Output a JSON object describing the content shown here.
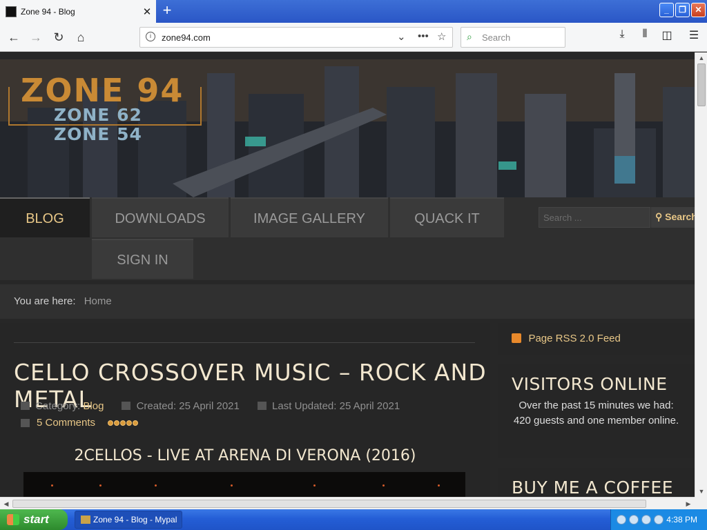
{
  "browser": {
    "tab_title": "Zone 94 - Blog",
    "new_tab": "+",
    "url": "zone94.com",
    "search_placeholder": "Search",
    "win_min": "_",
    "win_max": "❐",
    "win_close": "✕"
  },
  "site": {
    "logo_main": "ZONE 94",
    "logo_sub1": "ZONE 62",
    "logo_sub2": "ZONE 54",
    "nav": [
      "BLOG",
      "DOWNLOADS",
      "IMAGE GALLERY",
      "QUACK IT",
      "SIGN IN"
    ],
    "search_placeholder": "Search ...",
    "search_button": "Search",
    "breadcrumb_label": "You are here:",
    "breadcrumb_home": "Home"
  },
  "article": {
    "title": "CELLO CROSSOVER MUSIC – ROCK AND METAL",
    "category_label": "Category:",
    "category": "Blog",
    "created": "Created: 25 April 2021",
    "updated": "Last Updated: 25 April 2021",
    "comments": "5 Comments",
    "rating_stars": 5,
    "video_title": "2CELLOS - LIVE AT ARENA DI VERONA (2016)"
  },
  "sidebar": {
    "rss": "Page RSS 2.0 Feed",
    "visitors_heading": "VISITORS ONLINE",
    "visitors_text": "Over the past 15 minutes we had: 420 guests and one member online.",
    "coffee_heading": "BUY ME A COFFEE"
  },
  "taskbar": {
    "start": "start",
    "window": "Zone 94 - Blog - Mypal",
    "clock": "4:38 PM"
  },
  "colors": {
    "accent": "#e8c787",
    "title_text": "#f2e7cf",
    "logo_orange": "#c98a35"
  }
}
